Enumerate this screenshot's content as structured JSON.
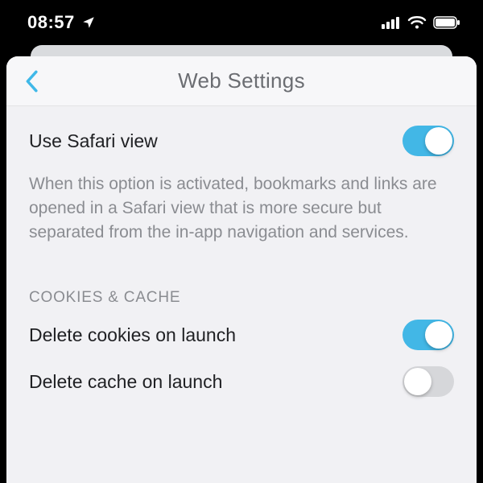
{
  "status_bar": {
    "time": "08:57",
    "location_icon": "location-arrow",
    "signal_icon": "cellular-signal",
    "wifi_icon": "wifi",
    "battery_icon": "battery-full"
  },
  "header": {
    "back_icon": "chevron-left",
    "title": "Web Settings"
  },
  "settings": {
    "safari": {
      "label": "Use Safari view",
      "on": true,
      "description": "When this option is activated, bookmarks and links are opened in a Safari view that is more secure but separated from the in-app navigation and services."
    },
    "section_cookies_cache": "COOKIES & CACHE",
    "delete_cookies": {
      "label": "Delete cookies on launch",
      "on": true
    },
    "delete_cache": {
      "label": "Delete cache on launch",
      "on": false
    }
  },
  "colors": {
    "accent": "#42b7e6",
    "toggle_off": "#d6d7da",
    "text_primary": "#1f2023",
    "text_secondary": "#8a8c91",
    "card_bg": "#f1f1f4"
  }
}
